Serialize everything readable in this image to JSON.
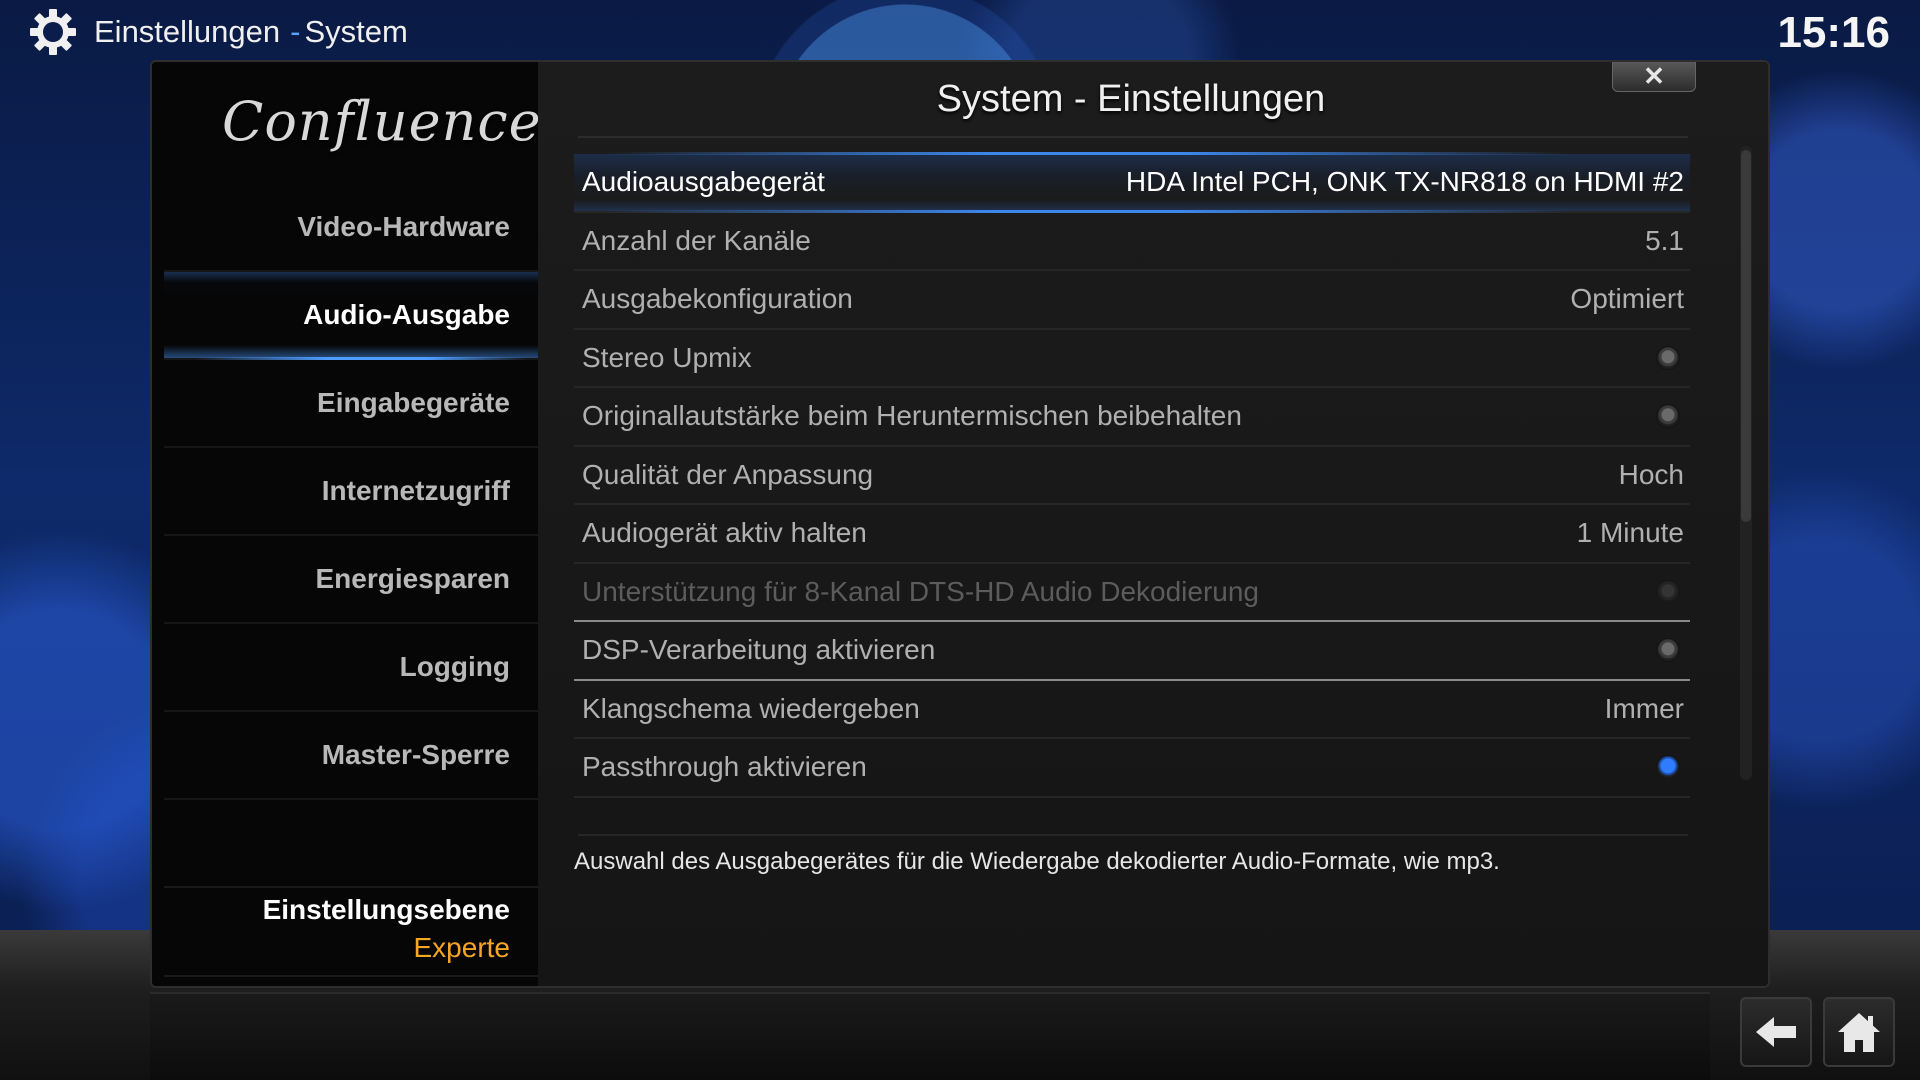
{
  "header": {
    "section": "Einstellungen",
    "separator": "-",
    "subsection": "System"
  },
  "clock": "15:16",
  "dialog": {
    "logo": "Confluence",
    "title": "System - Einstellungen",
    "close_label": "✕"
  },
  "sidebar": {
    "items": [
      {
        "label": "Video-Hardware"
      },
      {
        "label": "Audio-Ausgabe"
      },
      {
        "label": "Eingabegeräte"
      },
      {
        "label": "Internetzugriff"
      },
      {
        "label": "Energiesparen"
      },
      {
        "label": "Logging"
      },
      {
        "label": "Master-Sperre"
      }
    ],
    "active_index": 1,
    "settings_level_label": "Einstellungsebene",
    "settings_level_value": "Experte"
  },
  "settings": [
    {
      "label": "Audioausgabegerät",
      "value": "HDA Intel PCH, ONK TX-NR818 on HDMI #2"
    },
    {
      "label": "Anzahl der Kanäle",
      "value": "5.1"
    },
    {
      "label": "Ausgabekonfiguration",
      "value": "Optimiert"
    },
    {
      "label": "Stereo Upmix",
      "toggle": "off"
    },
    {
      "label": "Originallautstärke beim Heruntermischen beibehalten",
      "toggle": "off"
    },
    {
      "label": "Qualität der Anpassung",
      "value": "Hoch"
    },
    {
      "label": "Audiogerät aktiv halten",
      "value": "1 Minute"
    },
    {
      "label": "Unterstützung für 8-Kanal DTS-HD Audio Dekodierung",
      "toggle": "off",
      "disabled": true
    },
    {
      "label": "DSP-Verarbeitung aktivieren",
      "toggle": "off"
    },
    {
      "label": "Klangschema wiedergeben",
      "value": "Immer"
    },
    {
      "label": "Passthrough aktivieren",
      "toggle": "on"
    }
  ],
  "description": "Auswahl des Ausgabegerätes für die Wiedergabe dekodierter Audio-Formate, wie mp3.",
  "colors": {
    "accent": "#3d86ea",
    "level_value": "#f5a623",
    "toggle_on": "#2f7cff"
  },
  "icons": {
    "header": "gear-icon",
    "back": "back-arrow-icon",
    "home": "home-icon"
  }
}
